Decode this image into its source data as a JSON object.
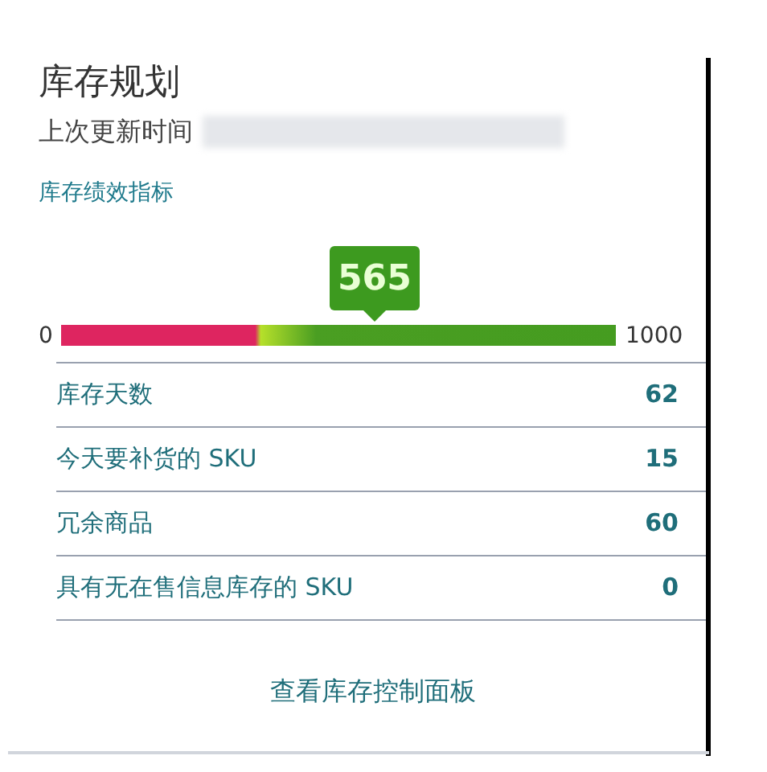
{
  "title": "库存规划",
  "last_updated_label": "上次更新时间",
  "metrics_link": "库存绩效指标",
  "gauge": {
    "min_label": "0",
    "max_label": "1000",
    "value_label": "565",
    "level": 0.565
  },
  "metrics": [
    {
      "label": "库存天数",
      "value": "62"
    },
    {
      "label": "今天要补货的 SKU",
      "value": "15"
    },
    {
      "label": "冗余商品",
      "value": "60"
    },
    {
      "label": "具有无在售信息库存的 SKU",
      "value": "0"
    }
  ],
  "dashboard_link": "查看库存控制面板"
}
